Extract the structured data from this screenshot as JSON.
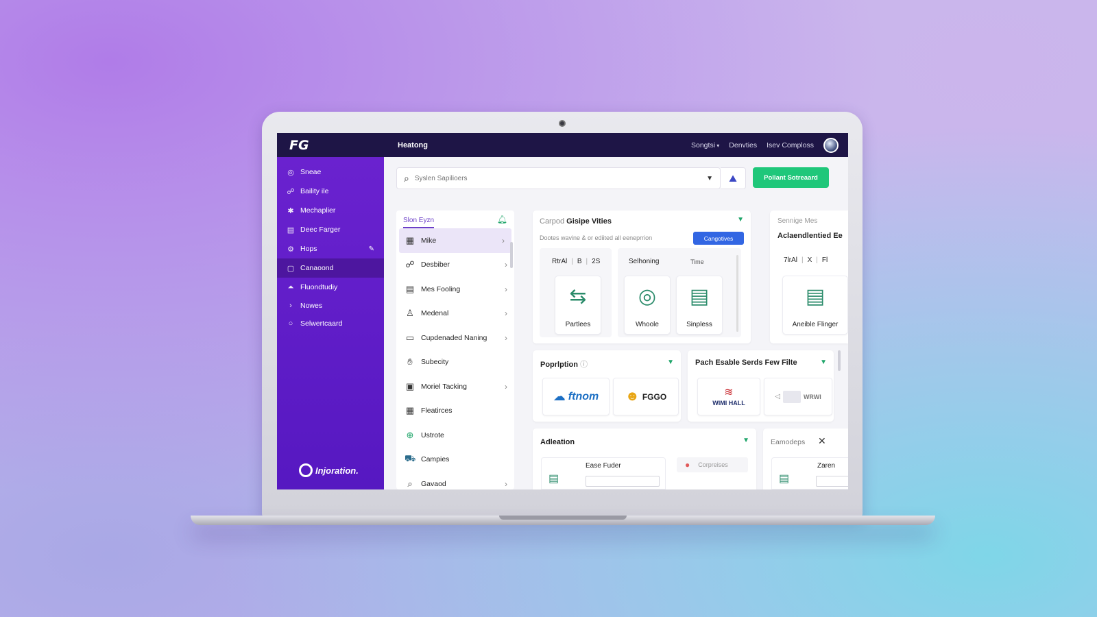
{
  "header": {
    "logo": "FG",
    "title": "Heatong",
    "nav": [
      "Songtsi",
      "Denvties",
      "Isev Comploss"
    ]
  },
  "sidebar": {
    "items": [
      {
        "label": "Sneae",
        "icon": "circle-gauge-icon"
      },
      {
        "label": "Baility ile",
        "icon": "users-icon"
      },
      {
        "label": "Mechaplier",
        "icon": "asterisk-icon"
      },
      {
        "label": "Deec Farger",
        "icon": "calendar-icon"
      },
      {
        "label": "Hops",
        "icon": "gear-icon"
      },
      {
        "label": "Canaoond",
        "icon": "box-icon"
      },
      {
        "label": "Fluondtudiy",
        "icon": "triangle-icon"
      },
      {
        "label": "Nowes",
        "icon": "chevron-right-icon"
      },
      {
        "label": "Selwertcaard",
        "icon": "circle-icon"
      }
    ],
    "brand": "Injoration."
  },
  "search": {
    "placeholder": "Syslen Sapilioers",
    "button_label": "Pollant Sotreaard"
  },
  "list": {
    "header": "Slon Eyzn",
    "items": [
      {
        "label": "Mike",
        "icon": "calendar-icon",
        "arrow": true
      },
      {
        "label": "Desbiber",
        "icon": "people-icon",
        "arrow": true
      },
      {
        "label": "Mes Fooling",
        "icon": "board-icon",
        "arrow": true
      },
      {
        "label": "Medenal",
        "icon": "person-icon",
        "arrow": true
      },
      {
        "label": "Cupdenaded Naning",
        "icon": "window-icon",
        "arrow": true
      },
      {
        "label": "Subecity",
        "icon": "hand-icon",
        "arrow": false
      },
      {
        "label": "Moriel Tacking",
        "icon": "monitor-icon",
        "arrow": true
      },
      {
        "label": "Fleatirces",
        "icon": "grid-icon",
        "arrow": false
      },
      {
        "label": "Ustrote",
        "icon": "globe-icon",
        "arrow": false
      },
      {
        "label": "Campies",
        "icon": "bag-icon",
        "arrow": false
      },
      {
        "label": "Gavaod",
        "icon": "search-icon",
        "arrow": true
      }
    ]
  },
  "card1": {
    "title_muted": "Carpod",
    "title": "Gisipe Vities",
    "subtitle": "Dootes wavine & or ediited all eeneprrion",
    "button": "Cangotives",
    "panel1_header": [
      "RtrAl",
      "B",
      "2S"
    ],
    "panel2_header": [
      "Selhoning",
      "Time"
    ],
    "tiles": [
      "Partlees",
      "Whoole",
      "Sinpless"
    ]
  },
  "card2": {
    "title_muted": "Sennige Mes",
    "title": "Aclaendlentied Ee",
    "header": [
      "7lrAl",
      "X",
      "Fl"
    ],
    "tile": "Aneible Flinger"
  },
  "card3": {
    "title": "Poprlption",
    "logos": [
      "ftnom",
      "FGGO"
    ]
  },
  "card4": {
    "title": "Pach Esable Serds Few Filte",
    "logos": [
      "WIMI HALL",
      "WRWI"
    ]
  },
  "card5": {
    "title": "Adleation",
    "field_label": "Ease Fuder",
    "chip": "Corpreises"
  },
  "card6": {
    "title": "Eamodeps",
    "field_label": "Zaren"
  },
  "colors": {
    "sidebar": "#5c1bc7",
    "topbar": "#1e1546",
    "accent_green": "#1fc77a",
    "accent_blue": "#3266e3"
  }
}
